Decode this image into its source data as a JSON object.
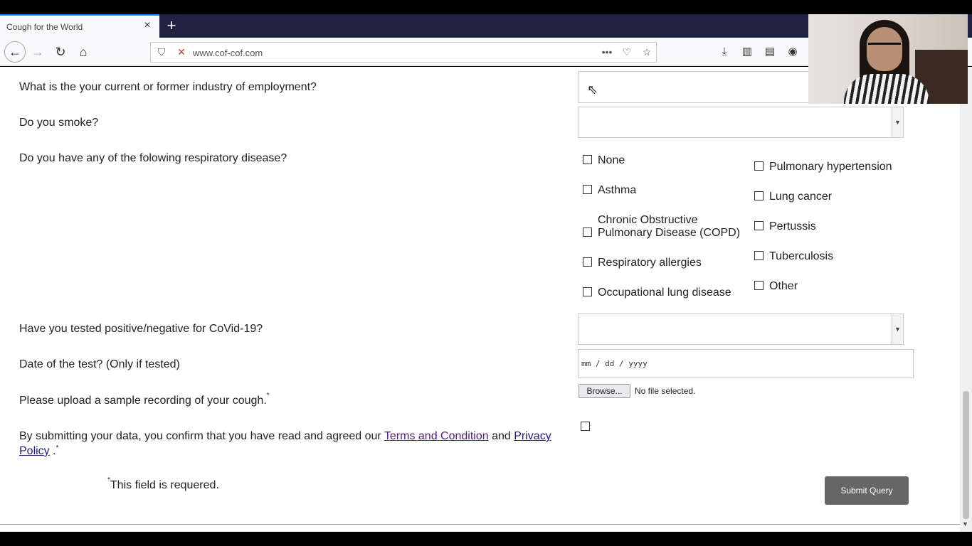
{
  "browser": {
    "tab_title": "Cough for the World",
    "tab_close_icon": "×",
    "new_tab_icon": "+",
    "url": "www.cof-cof.com"
  },
  "form": {
    "q_industry": "What is the your current or former industry of employment?",
    "q_smoke": "Do you smoke?",
    "q_respiratory": "Do you have any of the folowing respiratory disease?",
    "q_covid": "Have you tested positive/negative for CoVid-19?",
    "q_date": "Date of the test? (Only if tested)",
    "q_upload": "Please upload a sample recording of your cough.",
    "required_mark": "*",
    "diseases_left": [
      "None",
      "Asthma",
      "Chronic Obstructive",
      "Pulmonary Disease (COPD)",
      "Respiratory allergies",
      "Occupational lung disease"
    ],
    "diseases_right": [
      "Pulmonary hypertension",
      "Lung cancer",
      "Pertussis",
      "Tuberculosis",
      "Other"
    ],
    "date_placeholder": "mm / dd / yyyy",
    "browse_label": "Browse...",
    "no_file": "No file selected.",
    "consent_prefix": "By submitting your data, you confirm that you have read and agreed our ",
    "terms_link": "Terms and Condition",
    "consent_and": " and ",
    "privacy_link_1": "Privacy",
    "privacy_link_2": "Policy",
    "consent_suffix": " .",
    "required_note": "This field is requered.",
    "submit_label": "Submit Query"
  }
}
